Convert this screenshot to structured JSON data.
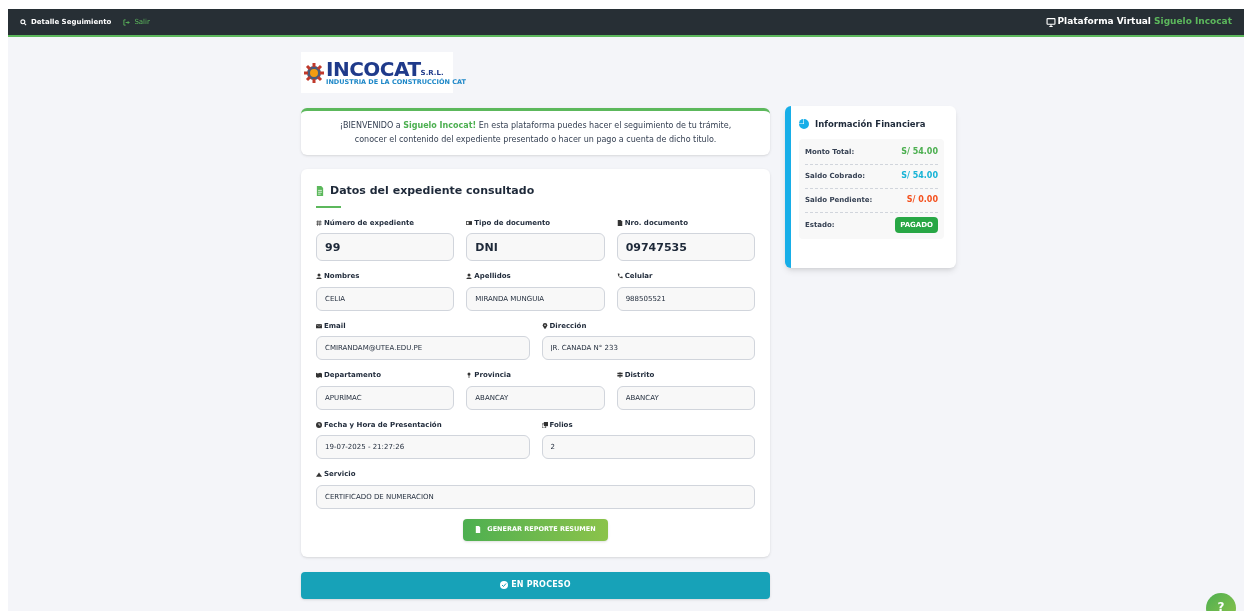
{
  "navbar": {
    "links": [
      {
        "label": "Detalle Seguimiento",
        "kind": "search"
      },
      {
        "label": "Salir",
        "kind": "exit"
      }
    ],
    "brand": {
      "text": "Plataforma Virtual",
      "highlight": "Siguelo Incocat"
    }
  },
  "logo": {
    "name": "INCOCAT",
    "suffix": "S.R.L.",
    "tagline": "INDUSTRIA DE LA CONSTRUCCIÓN CAT"
  },
  "welcome": {
    "text": "¡BIENVENIDO a **Siguelo Incocat!** En esta plataforma puedes hacer el seguimiento de tu trámite, conocer el contenido del expediente presentado o hacer un pago a cuenta de dicho titulo."
  },
  "expediente": {
    "title": "Datos del expediente consultado",
    "rows": [
      [
        {
          "label": "Número de expediente",
          "value": "99",
          "kind": "large"
        },
        {
          "label": "Tipo de documento",
          "value": "DNI",
          "kind": "large"
        },
        {
          "label": "Nro. documento",
          "value": "09747535",
          "kind": "large"
        }
      ],
      [
        {
          "label": "Nombres",
          "value": "CELIA",
          "kind": "normal"
        },
        {
          "label": "Apellidos",
          "value": "MIRANDA MUNGUIA",
          "kind": "normal"
        },
        {
          "label": "Celular",
          "value": "988505521",
          "kind": "normal"
        }
      ],
      [
        {
          "label": "Email",
          "value": "CMIRANDAM@UTEA.EDU.PE",
          "kind": "normal"
        },
        {
          "label": "Dirección",
          "value": "JR. CANADA N° 233",
          "kind": "normal"
        }
      ],
      [
        {
          "label": "Departamento",
          "value": "APURÍMAC",
          "kind": "normal"
        },
        {
          "label": "Provincia",
          "value": "ABANCAY",
          "kind": "normal"
        },
        {
          "label": "Distrito",
          "value": "ABANCAY",
          "kind": "normal"
        }
      ],
      [
        {
          "label": "Fecha y Hora de Presentación",
          "value": "19-07-2025 - 21:27:26",
          "kind": "normal"
        },
        {
          "label": "Folios",
          "value": "2",
          "kind": "normal"
        }
      ],
      [
        {
          "label": "Servicio",
          "value": "CERTIFICADO DE NUMERACION",
          "kind": "normal"
        }
      ]
    ],
    "button": "GENERAR REPORTE RESUMEN"
  },
  "status_bar": {
    "label": "EN PROCESO"
  },
  "financiera": {
    "title": "Información Financiera",
    "rows": [
      {
        "label": "Monto Total:",
        "value": "S/ 54.00",
        "kind": "amount",
        "color": "#4caf50"
      },
      {
        "label": "Saldo Cobrado:",
        "value": "S/ 54.00",
        "kind": "amount",
        "color": "#17b3d6"
      },
      {
        "label": "Saldo Pendiente:",
        "value": "S/ 0.00",
        "kind": "amount",
        "color": "#f4511e"
      },
      {
        "label": "Estado:",
        "value": "PAGADO",
        "kind": "badge",
        "color": "#28a745"
      }
    ]
  },
  "help_button": {
    "label": "?"
  }
}
